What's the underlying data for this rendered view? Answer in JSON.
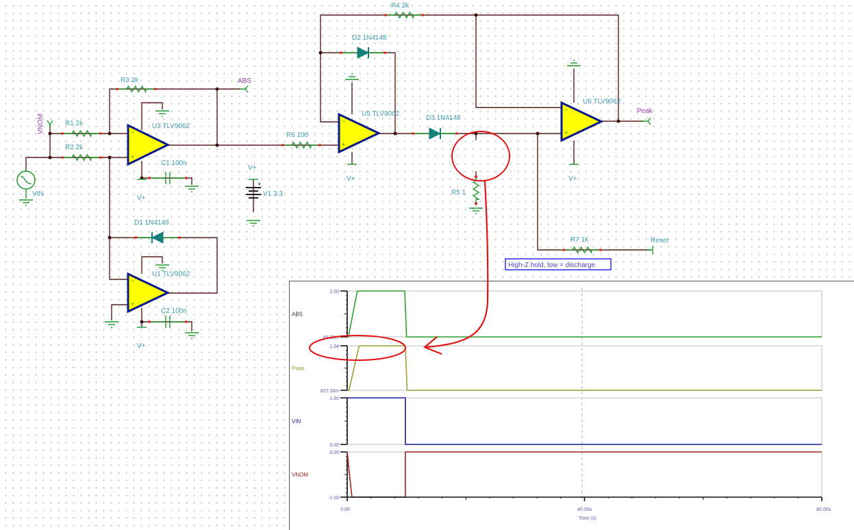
{
  "schematic": {
    "components": {
      "R1": "R1 2k",
      "R2": "R2 2k",
      "R3": "R3 2k",
      "R4": "R4 2k",
      "R5": "R5 1",
      "R6": "R6 100",
      "R7": "R7 1k",
      "C1": "C1 100n",
      "C2": "C2 100n",
      "D1": "D1 1N4148",
      "D2": "D2 1N4148",
      "D3": "D3 1N4148",
      "U1": "U1 TLV9062",
      "U3": "U3 TLV9062",
      "U5": "U5 TLV9062",
      "U6": "U6 TLV9062",
      "V1": "V1 3.3",
      "VIN": "VIN"
    },
    "supply_label": "V+",
    "nets": {
      "VNOM": "VNOM",
      "ABS": "ABS",
      "Peak": "Peak",
      "Reset": "Reset"
    },
    "note": "High-Z hold, low = discharge",
    "colors": {
      "wire": "#5a1e1e",
      "component": "#1f9a2a",
      "opamp_fill": "#ffff00",
      "opamp_stroke": "#0a1a8a",
      "annotation": "#e01515",
      "note_border": "#2a2aff"
    }
  },
  "chart_data": {
    "type": "line",
    "xlabel": "Time (s)",
    "x_ticks": [
      "0.00",
      "40.00u",
      "80.00u"
    ],
    "xlim_us": [
      0,
      80
    ],
    "grid": "vertical dashed at 40.00u",
    "panels": [
      {
        "name": "ABS",
        "color": "#2ca02c",
        "ylim": [
          0.0458,
          1.0
        ],
        "ytick_labels": [
          "1.00",
          "45.80m"
        ],
        "x_us": [
          0,
          0.2,
          1.7,
          9.7,
          10.0,
          80
        ],
        "y": [
          0.0458,
          0.0458,
          1.0,
          1.0,
          0.0458,
          0.0458
        ]
      },
      {
        "name": "Peak",
        "color": "#a0a030",
        "ylim": [
          0.6273,
          1.04
        ],
        "ytick_labels": [
          "1.04",
          "627.30m"
        ],
        "x_us": [
          0,
          0.3,
          2.0,
          9.8,
          10.1,
          80
        ],
        "y": [
          0.6273,
          0.6273,
          1.04,
          1.04,
          0.6273,
          0.6273
        ]
      },
      {
        "name": "VIN",
        "color": "#1a1aa0",
        "ylim": [
          0,
          1
        ],
        "ytick_labels": [
          "1.00",
          "0.00"
        ],
        "x_us": [
          0,
          9.8,
          9.8,
          80
        ],
        "y": [
          1,
          1,
          0,
          0
        ]
      },
      {
        "name": "VNOM",
        "color": "#a02020",
        "ylim": [
          -1,
          0
        ],
        "ytick_labels": [
          "0.00",
          "-1.00"
        ],
        "x_us": [
          0,
          0.3,
          0.8,
          9.8,
          9.8,
          80
        ],
        "y": [
          0,
          -0.4,
          -1,
          -1,
          0,
          0
        ]
      }
    ]
  }
}
